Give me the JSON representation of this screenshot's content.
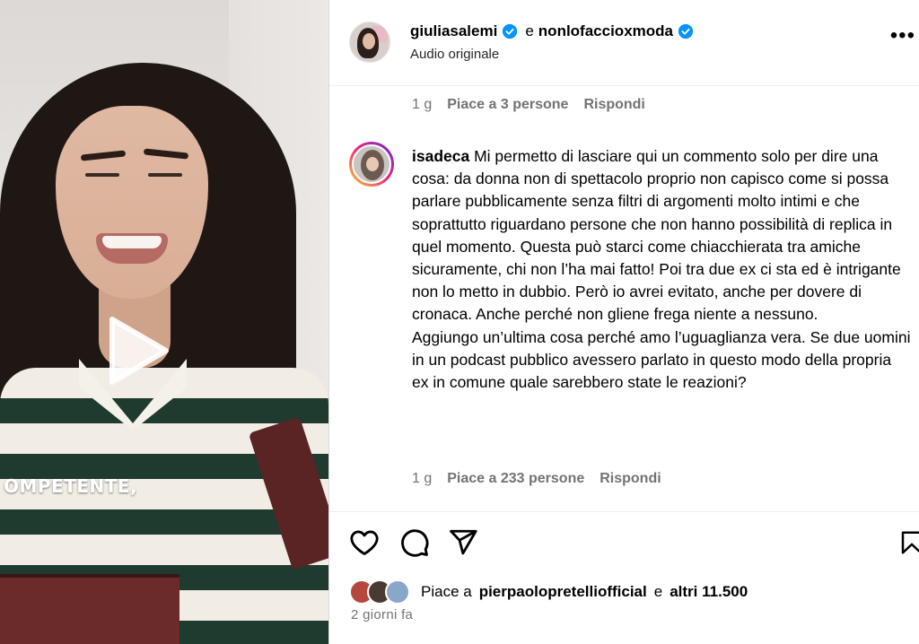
{
  "post": {
    "author": "giuliasalemi",
    "conjunction": "e",
    "collaborator": "nonlofaccioxmoda",
    "audio": "Audio originale",
    "more_icon": "more-horizontal-icon"
  },
  "video": {
    "caption": "OMPETENTE,",
    "play_icon": "play-icon"
  },
  "previous_comment": {
    "age": "1 g",
    "likes": "Piace a 3 persone",
    "reply": "Rispondi"
  },
  "comment": {
    "username": "isadeca",
    "text": " Mi permetto di lasciare qui un commento solo per dire una cosa: da donna non di spettacolo proprio non capisco come si possa parlare pubblicamente senza filtri di argomenti molto intimi e che soprattutto riguardano persone che non hanno possibilità di replica in quel momento. Questa può starci come chiacchierata tra amiche sicuramente, chi non l’ha mai fatto! Poi tra due ex ci sta ed è intrigante non lo metto in dubbio. Però io avrei evitato, anche per dovere di cronaca. Anche perché non gliene frega niente a nessuno.",
    "text2": "Aggiungo un’ultima cosa perché amo l’uguaglianza vera. Se due uomini in un podcast pubblico avessero parlato in questo modo della propria ex in comune quale sarebbero state le reazioni?",
    "age": "1 g",
    "likes": "Piace a 233 persone",
    "reply": "Rispondi"
  },
  "actions": {
    "like_icon": "heart-icon",
    "comment_icon": "comment-icon",
    "share_icon": "share-icon",
    "save_icon": "bookmark-icon"
  },
  "likes_summary": {
    "prefix": "Piace a",
    "user": "pierpaolopretelliofficial",
    "middle": "e",
    "others": "altri 11.500"
  },
  "timestamp": "2 giorni fa",
  "colors": {
    "verified": "#0095f6",
    "meta_text": "#737373"
  }
}
